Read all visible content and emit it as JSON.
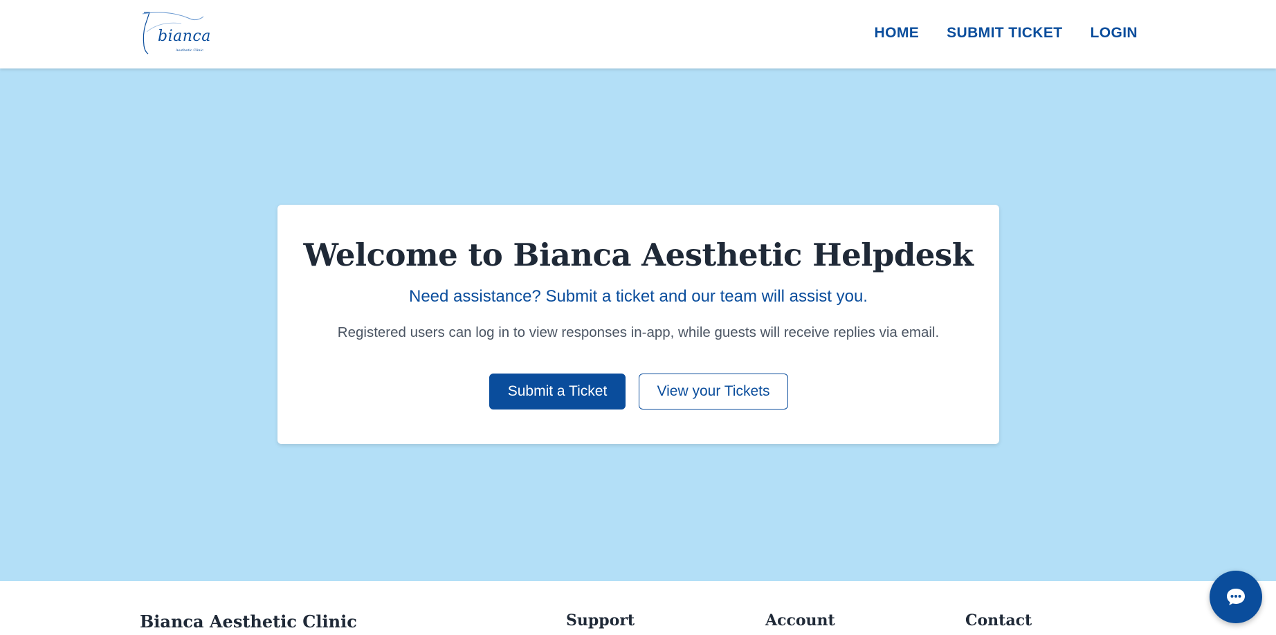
{
  "header": {
    "logo": {
      "wordmark": "bianca",
      "subtitle": "Aesthetic Clinic"
    },
    "nav": [
      {
        "label": "HOME"
      },
      {
        "label": "SUBMIT TICKET"
      },
      {
        "label": "LOGIN"
      }
    ]
  },
  "hero": {
    "title": "Welcome to Bianca Aesthetic Helpdesk",
    "lead": "Need assistance? Submit a ticket and our team will assist you.",
    "description": "Registered users can log in to view responses in-app, while guests will receive replies via email.",
    "primary_button": "Submit a Ticket",
    "secondary_button": "View your Tickets"
  },
  "footer": {
    "brand": "Bianca Aesthetic Clinic",
    "columns": [
      {
        "title": "Support"
      },
      {
        "title": "Account"
      },
      {
        "title": "Contact"
      }
    ]
  },
  "chat_widget": {
    "icon": "chat-bubble-icon"
  },
  "colors": {
    "brand": "#0a4d9c",
    "hero_bg": "#b3dff7",
    "heading": "#1f2937",
    "text_muted": "#4b5563"
  }
}
